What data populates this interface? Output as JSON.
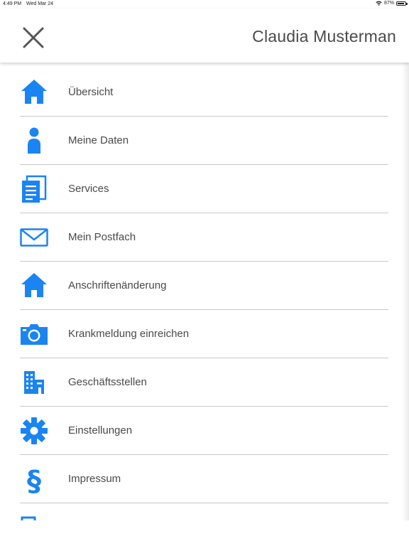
{
  "status_bar": {
    "time": "4:49 PM",
    "date": "Wed Mar 24",
    "battery": "87%",
    "battery_level": 0.87
  },
  "header": {
    "title": "Claudia Musterman",
    "close_icon": "close-icon"
  },
  "colors": {
    "accent": "#1a84f2",
    "text": "#4a4a4a",
    "divider": "#c9c9c9"
  },
  "menu": {
    "items": [
      {
        "label": "Übersicht",
        "icon": "home-icon"
      },
      {
        "label": "Meine Daten",
        "icon": "person-icon"
      },
      {
        "label": "Services",
        "icon": "documents-icon"
      },
      {
        "label": "Mein Postfach",
        "icon": "mail-icon"
      },
      {
        "label": "Anschriftenänderung",
        "icon": "home-icon"
      },
      {
        "label": "Krankmeldung einreichen",
        "icon": "camera-icon"
      },
      {
        "label": "Geschäftsstellen",
        "icon": "building-icon"
      },
      {
        "label": "Einstellungen",
        "icon": "gear-icon"
      },
      {
        "label": "Impressum",
        "icon": "paragraph-icon"
      },
      {
        "label": "",
        "icon": "logout-icon"
      }
    ]
  }
}
